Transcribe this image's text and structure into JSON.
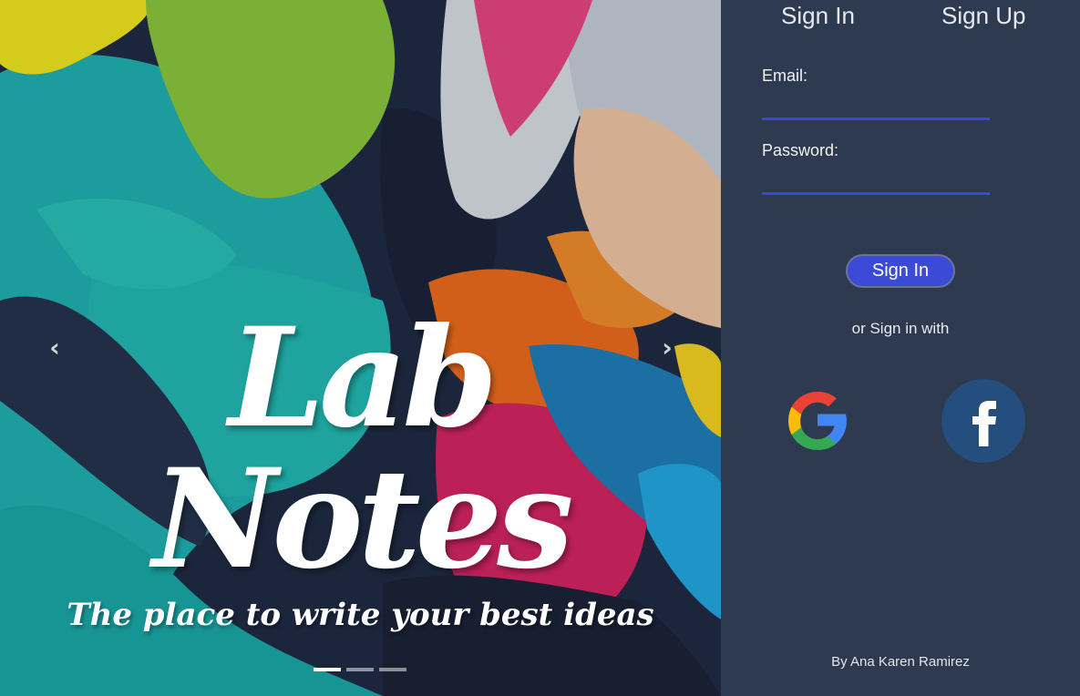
{
  "carousel": {
    "title_line1": "Lab",
    "title_line2": "Notes",
    "tagline": "The place to write your best ideas",
    "prev_arrow": "‹",
    "next_arrow": "›",
    "indicator_count": 3,
    "active_indicator": 0
  },
  "auth": {
    "tab_signin": "Sign In",
    "tab_signup": "Sign Up",
    "email_label": "Email:",
    "email_value": "",
    "password_label": "Password:",
    "password_value": "",
    "submit_label": "Sign In",
    "alt_signin_text": "or Sign in with",
    "social": [
      "google-icon",
      "facebook-icon"
    ]
  },
  "footer": {
    "credit": "By Ana Karen Ramirez"
  },
  "colors": {
    "panel_bg": "#2e3a50",
    "accent": "#3b4bd8",
    "facebook_blue": "#244e7d"
  }
}
